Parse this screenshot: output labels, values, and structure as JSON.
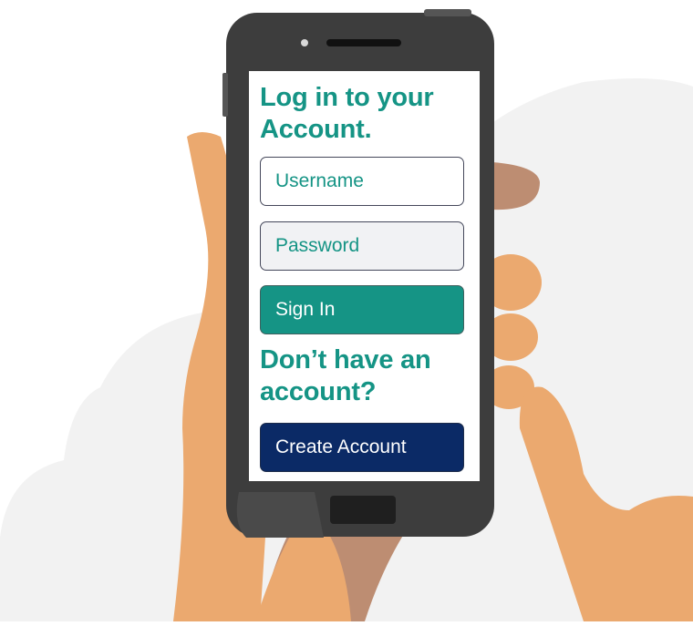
{
  "login": {
    "heading": "Log in to your Account.",
    "username_placeholder": "Username",
    "password_placeholder": "Password",
    "signin_label": "Sign In"
  },
  "signup": {
    "heading": "Don’t have an account?",
    "create_label": "Create Account"
  },
  "colors": {
    "accent_teal": "#159485",
    "navy_button": "#0b2a66",
    "phone_body": "#3d3d3d",
    "skin_light": "#eba96f",
    "skin_dark": "#bd8d72",
    "background_blob": "#f2f2f2"
  },
  "icons": {
    "camera": "front-camera-icon",
    "speaker": "earpiece-speaker-icon",
    "home": "home-button-icon"
  }
}
